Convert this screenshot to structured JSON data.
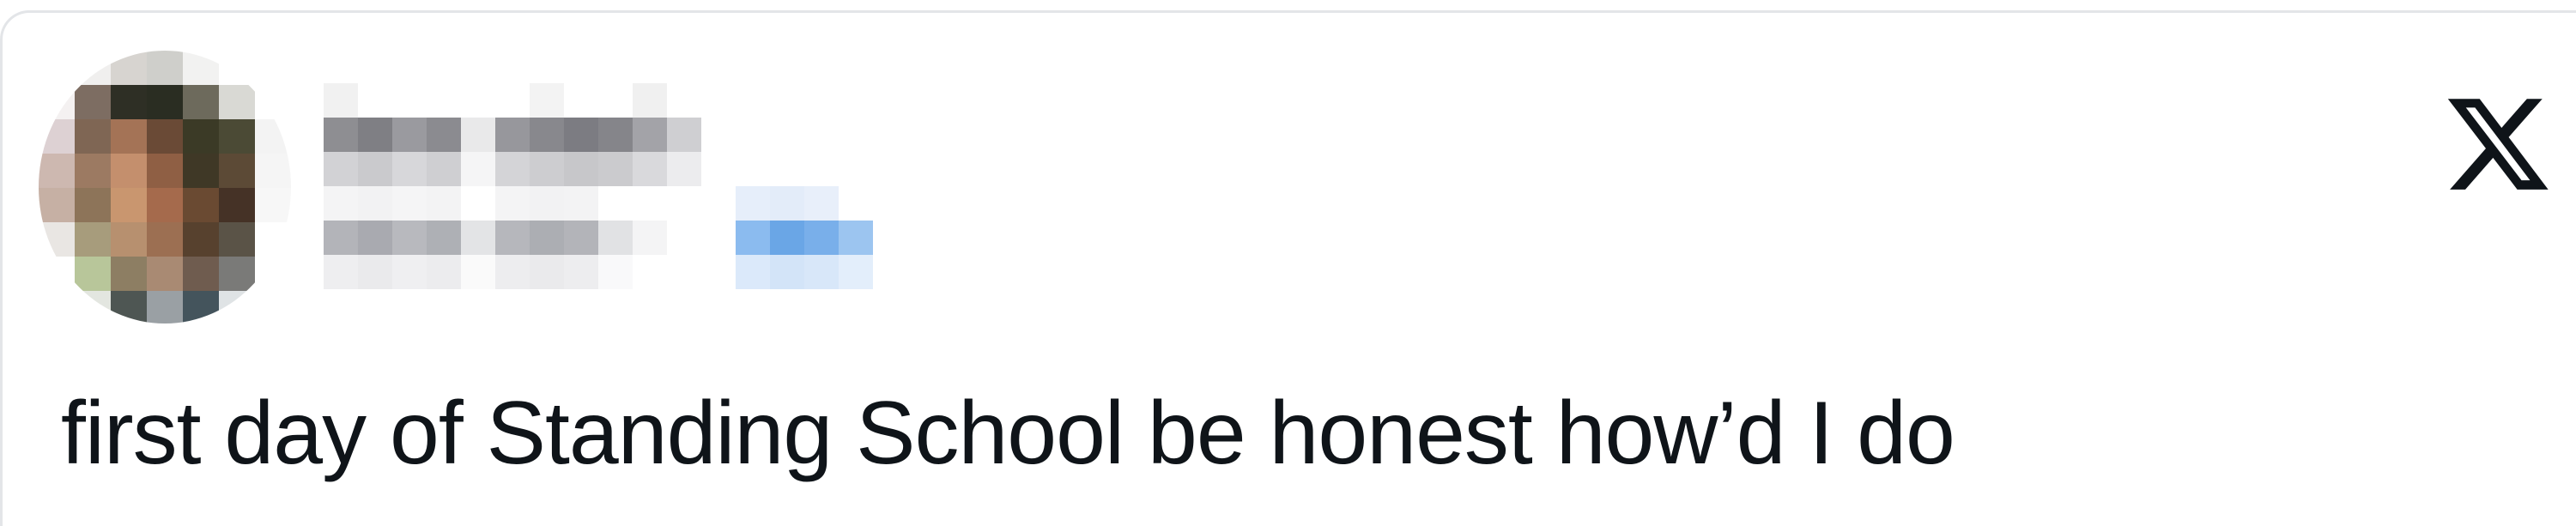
{
  "tweet": {
    "text": "first day of Standing School be honest how’d I do",
    "platform_icon": "x-logo-icon"
  },
  "author": {
    "avatar_icon": "avatar-image",
    "name_redacted": true,
    "handle_redacted": true,
    "follow_link_redacted": true
  },
  "colors": {
    "text": "#0f1419",
    "link_blue": "#6aa6e6",
    "border": "#e3e5e8",
    "background": "#ffffff"
  }
}
